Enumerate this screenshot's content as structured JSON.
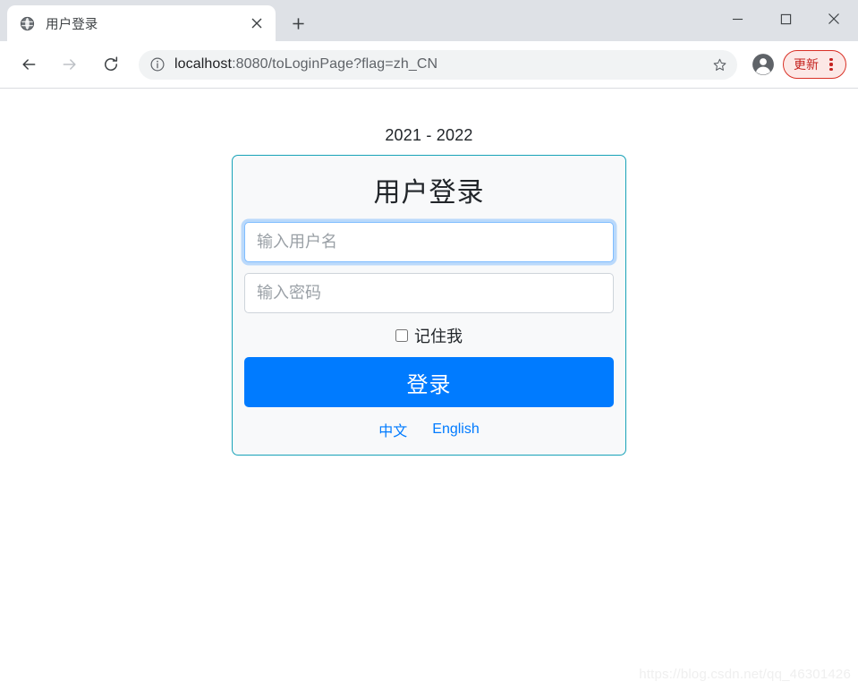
{
  "window": {
    "controls": {
      "minimize": "minimize-icon",
      "maximize": "maximize-icon",
      "close": "close-icon"
    }
  },
  "tabstrip": {
    "tabs": [
      {
        "title": "用户登录",
        "favicon": "globe-icon",
        "close_label": "×",
        "active": true
      }
    ],
    "new_tab_label": "+"
  },
  "toolbar": {
    "back_icon": "back-arrow-icon",
    "forward_icon": "forward-arrow-icon",
    "reload_icon": "reload-icon",
    "site_info_icon": "info-circle-icon",
    "url_host": "localhost",
    "url_rest": ":8080/toLoginPage?flag=zh_CN",
    "url_full": "localhost:8080/toLoginPage?flag=zh_CN",
    "bookmark_icon": "star-icon",
    "profile_icon": "account-avatar-icon",
    "update_label": "更新",
    "menu_icon": "three-dot-menu-icon"
  },
  "page": {
    "heading": "2021 - 2022",
    "card": {
      "title": "用户登录",
      "username": {
        "value": "",
        "placeholder": "输入用户名",
        "focused": true
      },
      "password": {
        "value": "",
        "placeholder": "输入密码",
        "focused": false
      },
      "remember": {
        "label": "记住我",
        "checked": false
      },
      "submit_label": "登录",
      "languages": [
        {
          "label": "中文"
        },
        {
          "label": "English"
        }
      ]
    },
    "watermark": "https://blog.csdn.net/qq_46301426"
  },
  "colors": {
    "primary_blue": "#007bff",
    "card_border_teal": "#17a2b8",
    "card_bg": "#f8f9fa",
    "update_red": "#d93025",
    "focus_ring": "#80bdff",
    "tabstrip_bg": "#dee1e6",
    "omnibox_bg": "#f1f3f4"
  }
}
